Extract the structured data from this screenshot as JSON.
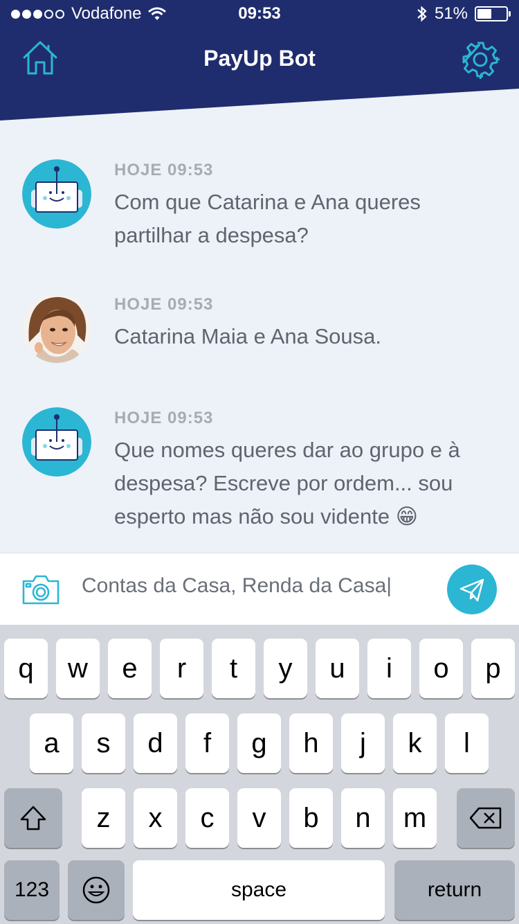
{
  "status_bar": {
    "carrier": "Vodafone",
    "time": "09:53",
    "battery": "51%",
    "battery_level": 0.51
  },
  "header": {
    "title": "PayUp Bot",
    "home_icon": "home-icon",
    "settings_icon": "gear-icon"
  },
  "messages": [
    {
      "sender": "bot",
      "time": "HOJE 09:53",
      "text": "Com que Catarina e Ana queres partilhar a despesa?"
    },
    {
      "sender": "user",
      "time": "HOJE 09:53",
      "text": "Catarina Maia e Ana Sousa."
    },
    {
      "sender": "bot",
      "time": "HOJE 09:53",
      "text": "Que nomes queres dar ao grupo e à despesa? Escreve por ordem... sou esperto mas não sou vidente 😁"
    }
  ],
  "input": {
    "value": "Contas da Casa, Renda da Casa|",
    "camera_icon": "camera-icon",
    "send_icon": "send-icon"
  },
  "keyboard": {
    "row1": [
      "q",
      "w",
      "e",
      "r",
      "t",
      "y",
      "u",
      "i",
      "o",
      "p"
    ],
    "row2": [
      "a",
      "s",
      "d",
      "f",
      "g",
      "h",
      "j",
      "k",
      "l"
    ],
    "row3": [
      "z",
      "x",
      "c",
      "v",
      "b",
      "n",
      "m"
    ],
    "numbers_label": "123",
    "space_label": "space",
    "return_label": "return"
  },
  "colors": {
    "header": "#1f2d6e",
    "accent": "#2bb6d3",
    "background": "#ecf2f7"
  }
}
